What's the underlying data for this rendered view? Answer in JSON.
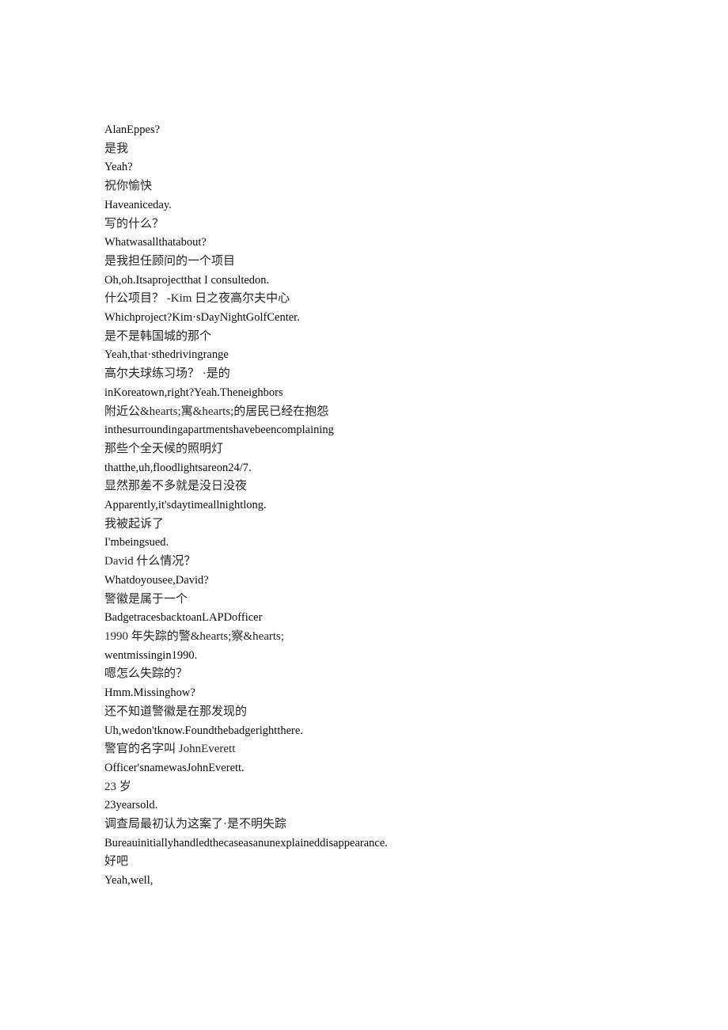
{
  "document": {
    "type": "bilingual-subtitle-transcript",
    "background_color": "#ffffff",
    "text_color": "#111111",
    "lines": [
      {
        "id": 1,
        "lang": "en",
        "text": "AlanEppes?"
      },
      {
        "id": 2,
        "lang": "zh",
        "text": "是我"
      },
      {
        "id": 3,
        "lang": "en",
        "text": "Yeah?"
      },
      {
        "id": 4,
        "lang": "zh",
        "text": "祝你愉快"
      },
      {
        "id": 5,
        "lang": "en",
        "text": "Haveaniceday."
      },
      {
        "id": 6,
        "lang": "zh",
        "text": "写的什么？"
      },
      {
        "id": 7,
        "lang": "en",
        "text": "Whatwasallthatabout?"
      },
      {
        "id": 8,
        "lang": "zh",
        "text": "是我担任顾问的一个项目"
      },
      {
        "id": 9,
        "lang": "en",
        "text": "Oh,oh.Itsaprojectthat I consultedon."
      },
      {
        "id": 10,
        "lang": "zh",
        "text": "什公项目？ -Kim 日之夜高尔夫中心"
      },
      {
        "id": 11,
        "lang": "en",
        "text": "Whichproject?Kim·sDayNightGolfCenter."
      },
      {
        "id": 12,
        "lang": "zh",
        "text": "是不是韩国城的那个"
      },
      {
        "id": 13,
        "lang": "en",
        "text": "Yeah,that·sthedrivingrange"
      },
      {
        "id": 14,
        "lang": "zh",
        "text": "高尔夫球练习场？ ·是的"
      },
      {
        "id": 15,
        "lang": "en",
        "text": "inKoreatown,right?Yeah.Theneighbors"
      },
      {
        "id": 16,
        "lang": "zh",
        "text": "附近公&hearts;寓&hearts;的居民已经在抱怨"
      },
      {
        "id": 17,
        "lang": "en",
        "text": "inthesurroundingapartmentshavebeencomplaining"
      },
      {
        "id": 18,
        "lang": "zh",
        "text": "那些个全天候的照明灯"
      },
      {
        "id": 19,
        "lang": "en",
        "text": "thatthe,uh,floodlightsareon24/7."
      },
      {
        "id": 20,
        "lang": "zh",
        "text": "显然那差不多就是没日没夜"
      },
      {
        "id": 21,
        "lang": "en",
        "text": "Apparently,it'sdaytimeallnightlong."
      },
      {
        "id": 22,
        "lang": "zh",
        "text": "我被起诉了"
      },
      {
        "id": 23,
        "lang": "en",
        "text": "I'mbeingsued."
      },
      {
        "id": 24,
        "lang": "zh",
        "text": "David 什么情况？"
      },
      {
        "id": 25,
        "lang": "en",
        "text": "Whatdoyousee,David?"
      },
      {
        "id": 26,
        "lang": "zh",
        "text": "警徽是属于一个"
      },
      {
        "id": 27,
        "lang": "en",
        "text": "BadgetracesbacktoanLAPDofficer"
      },
      {
        "id": 28,
        "lang": "zh",
        "text": "1990 年失踪的警&hearts;察&hearts;"
      },
      {
        "id": 29,
        "lang": "en",
        "text": "wentmissingin1990."
      },
      {
        "id": 30,
        "lang": "zh",
        "text": "嗯怎么失踪的？"
      },
      {
        "id": 31,
        "lang": "en",
        "text": "Hmm.Missinghow?"
      },
      {
        "id": 32,
        "lang": "zh",
        "text": "还不知道警徽是在那发现的"
      },
      {
        "id": 33,
        "lang": "en",
        "text": "Uh,wedon'tknow.Foundthebadgerightthere."
      },
      {
        "id": 34,
        "lang": "zh",
        "text": "警官的名字叫 JohnEverett"
      },
      {
        "id": 35,
        "lang": "en",
        "text": "Officer'snamewasJohnEverett."
      },
      {
        "id": 36,
        "lang": "zh",
        "text": "23 岁"
      },
      {
        "id": 37,
        "lang": "en",
        "text": "23yearsold."
      },
      {
        "id": 38,
        "lang": "zh",
        "text": "调查局最初认为这案了·是不明失踪"
      },
      {
        "id": 39,
        "lang": "en",
        "text": "Bureauinitiallyhandledthecaseasanunexplaineddisappearance."
      },
      {
        "id": 40,
        "lang": "zh",
        "text": "好吧"
      },
      {
        "id": 41,
        "lang": "en",
        "text": "Yeah,well,"
      }
    ]
  }
}
